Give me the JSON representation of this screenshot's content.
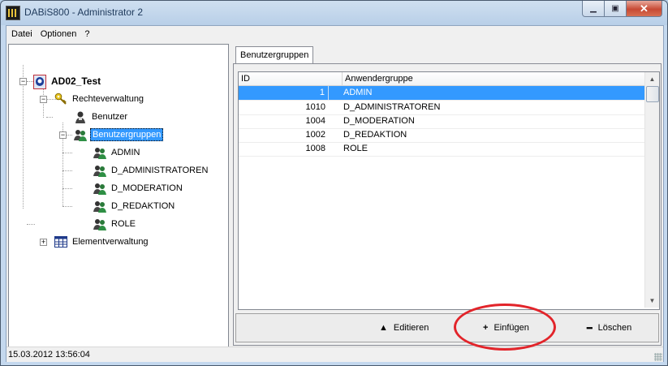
{
  "window": {
    "title": "DABiS800 - Administrator 2"
  },
  "menu": [
    "Datei",
    "Optionen",
    "?"
  ],
  "tree": {
    "root": "AD02_Test",
    "rechteverwaltung": "Rechteverwaltung",
    "benutzer": "Benutzer",
    "benutzergruppen": "Benutzergruppen",
    "groups": [
      "ADMIN",
      "D_ADMINISTRATOREN",
      "D_MODERATION",
      "D_REDAKTION",
      "ROLE"
    ],
    "elementverwaltung": "Elementverwaltung"
  },
  "tab": {
    "label": "Benutzergruppen"
  },
  "grid": {
    "columns": [
      "ID",
      "Anwendergruppe"
    ],
    "rows": [
      {
        "id": "1",
        "name": "ADMIN",
        "selected": true
      },
      {
        "id": "1010",
        "name": "D_ADMINISTRATOREN"
      },
      {
        "id": "1004",
        "name": "D_MODERATION"
      },
      {
        "id": "1002",
        "name": "D_REDAKTION"
      },
      {
        "id": "1008",
        "name": "ROLE"
      }
    ]
  },
  "buttons": {
    "edit": "Editieren",
    "insert": "Einfügen",
    "delete": "Löschen"
  },
  "status": {
    "datetime": "15.03.2012  13:56:04"
  },
  "colors": {
    "selection": "#3399ff",
    "annotation": "#e2242a"
  }
}
